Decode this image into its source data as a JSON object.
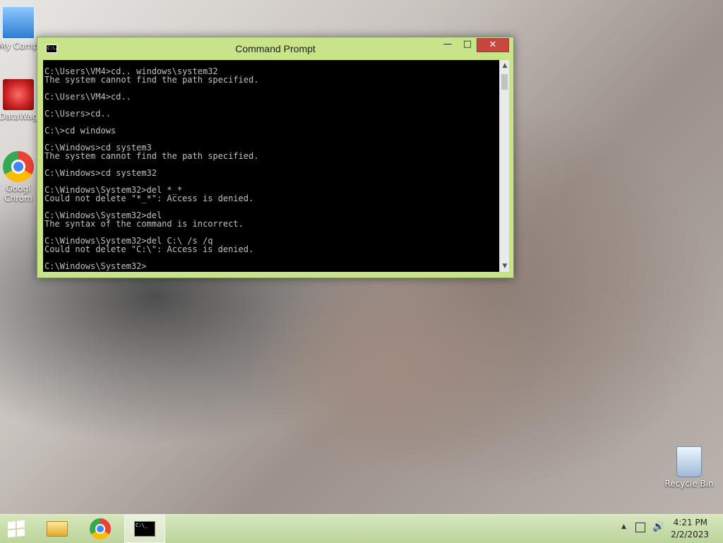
{
  "desktop": {
    "icons": [
      {
        "label": "My Comp",
        "icon": "computer-icon"
      },
      {
        "label": "DataWag",
        "icon": "datawagon-icon"
      },
      {
        "label": "Googl Chrom",
        "icon": "chrome-icon"
      },
      {
        "label": "Recycle Bin",
        "icon": "recycle-bin-icon"
      }
    ]
  },
  "window": {
    "title": "Command Prompt",
    "app_icon_text": "C:\\.",
    "minimize_glyph": "—",
    "maximize_glyph": "□",
    "close_glyph": "✕"
  },
  "console": {
    "lines": [
      "C:\\Users\\VM4>cd.. windows\\system32",
      "The system cannot find the path specified.",
      "",
      "C:\\Users\\VM4>cd..",
      "",
      "C:\\Users>cd..",
      "",
      "C:\\>cd windows",
      "",
      "C:\\Windows>cd system3",
      "The system cannot find the path specified.",
      "",
      "C:\\Windows>cd system32",
      "",
      "C:\\Windows\\System32>del *_*",
      "Could not delete \"*_*\": Access is denied.",
      "",
      "C:\\Windows\\System32>del",
      "The syntax of the command is incorrect.",
      "",
      "C:\\Windows\\System32>del C:\\ /s /q",
      "Could not delete \"C:\\\": Access is denied.",
      "",
      "C:\\Windows\\System32>"
    ]
  },
  "scrollbar": {
    "up_glyph": "▲",
    "down_glyph": "▼"
  },
  "taskbar": {
    "items": [
      "start-button",
      "file-explorer",
      "google-chrome",
      "command-prompt"
    ],
    "cmd_icon_text": "C:\\_",
    "tray": {
      "arrow_glyph": "▲",
      "volume_glyph": "🔊",
      "time": "4:21 PM",
      "date": "2/2/2023"
    }
  }
}
